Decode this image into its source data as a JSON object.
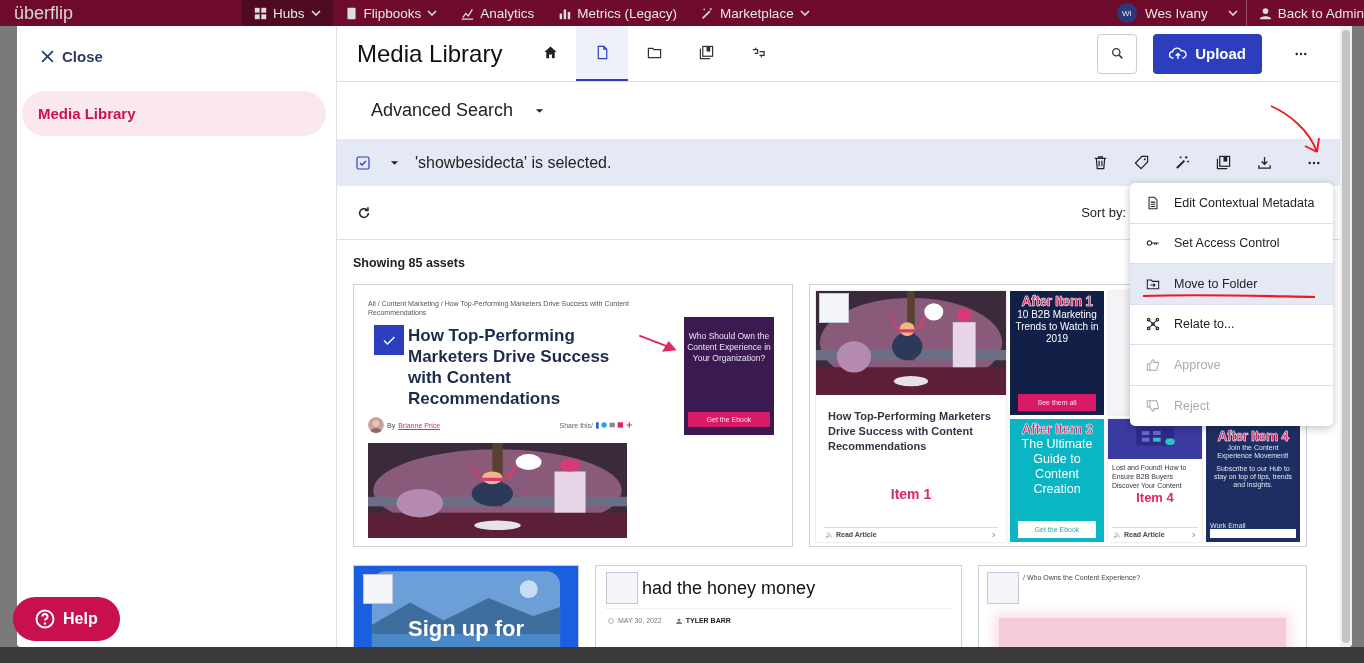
{
  "topbar": {
    "logo": "überflip",
    "nav": [
      {
        "label": "Hubs",
        "selected": true
      },
      {
        "label": "Flipbooks",
        "selected": false
      },
      {
        "label": "Analytics",
        "selected": false
      },
      {
        "label": "Metrics (Legacy)",
        "selected": false
      },
      {
        "label": "Marketplace",
        "selected": false
      }
    ],
    "user": {
      "initials": "WI",
      "name": "Wes Ivany"
    },
    "back": "Back to Admin"
  },
  "sidebar": {
    "close": "Close",
    "items": [
      {
        "label": "Media Library",
        "selected": true
      }
    ]
  },
  "header": {
    "title": "Media Library",
    "tabs": [
      {
        "kind": "home",
        "selected": false
      },
      {
        "kind": "file",
        "selected": true
      },
      {
        "kind": "folder",
        "selected": false
      },
      {
        "kind": "collection",
        "selected": false
      },
      {
        "kind": "link",
        "selected": false
      }
    ],
    "upload": "Upload"
  },
  "advanced_search": "Advanced Search",
  "selection": {
    "checked": true,
    "text": "'showbesidecta' is selected."
  },
  "sort_label": "Sort by:",
  "count": "Showing 85 assets",
  "menu": {
    "items": [
      {
        "label": "Edit Contextual Metadata",
        "selected": false,
        "disabled": false
      },
      {
        "label": "Set Access Control",
        "selected": false,
        "disabled": false
      },
      {
        "label": "Move to Folder",
        "selected": true,
        "disabled": false
      },
      {
        "label": "Relate to...",
        "selected": false,
        "disabled": false
      },
      {
        "label": "Approve",
        "selected": false,
        "disabled": true
      },
      {
        "label": "Reject",
        "selected": false,
        "disabled": true
      }
    ]
  },
  "assets": [
    {
      "kind": "article",
      "checked": true,
      "breadcrumb": "All / Content Marketing / How Top-Performing Marketers Drive Success with Content Recommendations",
      "title": "How Top-Performing Marketers Drive Success with Content Recommendations",
      "byline": "By",
      "author": "Brianne Price",
      "share": "Share this/",
      "cta": {
        "text": "Who Should Own the Content Experience in Your Organization?",
        "button": "Get the Ebook"
      }
    },
    {
      "kind": "stream",
      "checked": false,
      "tiles": [
        {
          "kind": "post",
          "title": "How Top-Performing Marketers Drive Success with Content Recommendations",
          "label": "Item 1",
          "link": "Read Article"
        },
        {
          "kind": "cta",
          "label": "After Item 1",
          "text": "10 B2B Marketing Trends to Watch in 2019",
          "button": "See them all"
        },
        {
          "kind": "blank"
        },
        {
          "kind": "cta",
          "label": "After Item 3",
          "text": "The Ultimate Guide to Content Creation",
          "button": "Get the Ebook"
        },
        {
          "kind": "post",
          "title": "Lost and Found! How to Ensure B2B Buyers Discover Your Content",
          "label": "Item 4",
          "link": "Read Article"
        },
        {
          "kind": "form",
          "label": "After Item 4",
          "text": "Join the Content Experience Movement!",
          "note": "Subscribe to our Hub to stay on top of tips, trends and insights.",
          "field": "Work Email"
        }
      ]
    },
    {
      "kind": "banner",
      "checked": false,
      "text": "Sign up for"
    },
    {
      "kind": "blog",
      "checked": false,
      "title": "had the honey money",
      "date": "MAY 30, 2022",
      "author": "TYLER BARR"
    },
    {
      "kind": "page",
      "checked": false,
      "breadcrumb": "/ Who Owns the Content Experience?"
    }
  ],
  "help": "Help"
}
